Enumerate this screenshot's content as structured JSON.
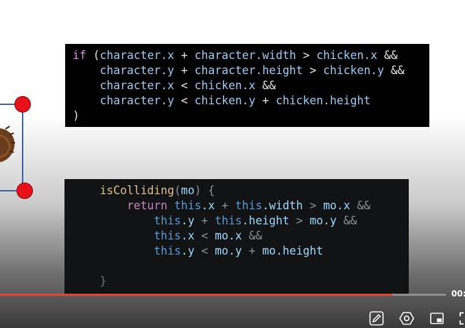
{
  "snippet_top": {
    "line1": {
      "kw": "if",
      "a": " (",
      "b": "character.x",
      "c": " + ",
      "d": "character.width",
      "e": " > ",
      "f": "chicken.x",
      "g": " &&"
    },
    "line2": {
      "indent": "    ",
      "b": "character.y",
      "c": " + ",
      "d": "character.height",
      "e": " > ",
      "f": "chicken.y",
      "g": " &&"
    },
    "line3": {
      "indent": "    ",
      "b": "character.x",
      "c": " < ",
      "f": "chicken.x",
      "g": " &&"
    },
    "line4": {
      "indent": "    ",
      "b": "character.y",
      "c": " < ",
      "d": "chicken.y",
      "e": " + ",
      "f": "chicken.height"
    },
    "line5": ")"
  },
  "snippet_bottom": {
    "l1": {
      "indent": "    ",
      "fn": "isColliding",
      "open": "(",
      "param": "mo",
      "close": ") {"
    },
    "l2": {
      "indent": "        ",
      "kw": "return",
      "t1": " this",
      "p1": ".x",
      "o1": " + ",
      "t2": "this",
      "p2": ".width",
      "o2": " > ",
      "m1": "mo.x",
      "o3": " &&"
    },
    "l3": {
      "indent": "            ",
      "t1": "this",
      "p1": ".y",
      "o1": " + ",
      "t2": "this",
      "p2": ".height",
      "o2": " > ",
      "m1": "mo.y",
      "o3": " &&"
    },
    "l4": {
      "indent": "            ",
      "t1": "this",
      "p1": ".x",
      "o1": " < ",
      "m1": "mo.x",
      "o3": " &&"
    },
    "l5": {
      "indent": "            ",
      "t1": "this",
      "p1": ".y",
      "o1": " < ",
      "m1": "mo.y",
      "o2": " + ",
      "m2": "mo.height"
    },
    "l6": "",
    "l7": {
      "indent": "    ",
      "close": "}"
    }
  },
  "player": {
    "progress": 0.88,
    "time_text": "00:",
    "accent_color": "#e0472b",
    "icons": [
      "edit-icon",
      "settings-icon",
      "picture-in-picture-icon",
      "fullscreen-icon"
    ]
  }
}
